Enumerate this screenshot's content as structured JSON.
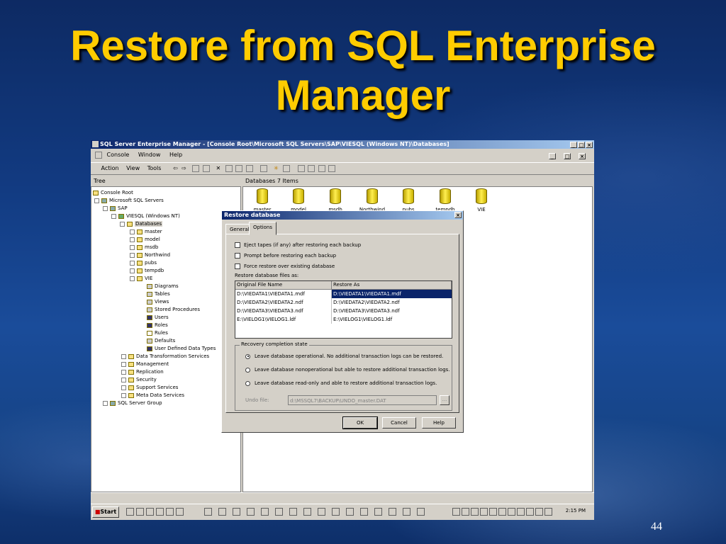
{
  "slide": {
    "title_line1": "Restore from SQL Enterprise",
    "title_line2": "Manager",
    "page_number": "44"
  },
  "window": {
    "title": "SQL Server Enterprise Manager - [Console Root\\Microsoft SQL Servers\\SAP\\VIESQL (Windows NT)\\Databases]",
    "menu": [
      "Console",
      "Window",
      "Help"
    ],
    "toolbar": [
      "Action",
      "View",
      "Tools"
    ]
  },
  "panes": {
    "tree_header": "Tree",
    "right_header": "Databases    7 Items"
  },
  "tree": [
    {
      "label": "Console Root"
    },
    {
      "label": "Microsoft SQL Servers"
    },
    {
      "label": "SAP"
    },
    {
      "label": "VIESQL (Windows NT)"
    },
    {
      "label": "Databases"
    },
    {
      "label": "master"
    },
    {
      "label": "model"
    },
    {
      "label": "msdb"
    },
    {
      "label": "Northwind"
    },
    {
      "label": "pubs"
    },
    {
      "label": "tempdb"
    },
    {
      "label": "VIE"
    },
    {
      "label": "Diagrams"
    },
    {
      "label": "Tables"
    },
    {
      "label": "Views"
    },
    {
      "label": "Stored Procedures"
    },
    {
      "label": "Users"
    },
    {
      "label": "Roles"
    },
    {
      "label": "Rules"
    },
    {
      "label": "Defaults"
    },
    {
      "label": "User Defined Data Types"
    },
    {
      "label": "Data Transformation Services"
    },
    {
      "label": "Management"
    },
    {
      "label": "Replication"
    },
    {
      "label": "Security"
    },
    {
      "label": "Support Services"
    },
    {
      "label": "Meta Data Services"
    },
    {
      "label": "SQL Server Group"
    }
  ],
  "databases": [
    "master",
    "model",
    "msdb",
    "Northwind",
    "pubs",
    "tempdb",
    "VIE"
  ],
  "dialog": {
    "title": "Restore database",
    "tabs": [
      "General",
      "Options"
    ],
    "checkboxes": [
      "Eject tapes (if any) after restoring each backup",
      "Prompt before restoring each backup",
      "Force restore over existing database"
    ],
    "files_label": "Restore database files as:",
    "columns": [
      "Original File Name",
      "Restore As"
    ],
    "files": [
      {
        "original": "D:\\VIEDATA1\\VIEDATA1.mdf",
        "restore_as": "D:\\VIEDATA1\\VIEDATA1.mdf"
      },
      {
        "original": "D:\\VIEDATA2\\VIEDATA2.ndf",
        "restore_as": "D:\\VIEDATA2\\VIEDATA2.ndf"
      },
      {
        "original": "D:\\VIEDATA3\\VIEDATA3.ndf",
        "restore_as": "D:\\VIEDATA3\\VIEDATA3.ndf"
      },
      {
        "original": "E:\\VIELOG1\\VIELOG1.ldf",
        "restore_as": "E:\\VIELOG1\\VIELOG1.ldf"
      }
    ],
    "recovery_label": "Recovery completion state",
    "radios": [
      "Leave database operational. No additional transaction logs can be restored.",
      "Leave database nonoperational but able to restore additional transaction logs.",
      "Leave database read-only and able to restore additional transaction logs."
    ],
    "undo_label": "Undo file:",
    "undo_value": "d:\\MSSQL7\\BACKUP\\UNDO_master.DAT",
    "browse_label": "...",
    "buttons": {
      "ok": "OK",
      "cancel": "Cancel",
      "help": "Help"
    }
  },
  "taskbar": {
    "start_label": "Start",
    "clock": "2:15 PM"
  },
  "colors": {
    "title_yellow": "#ffcc00",
    "selection_blue": "#0a246a",
    "window_gray": "#d4d0c8"
  }
}
